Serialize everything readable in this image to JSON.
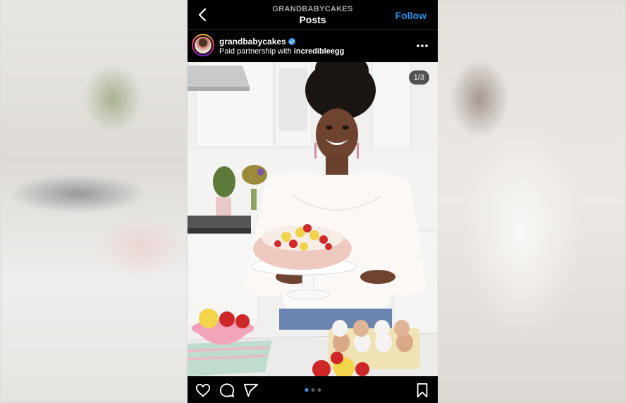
{
  "header": {
    "username": "GRANDBABYCAKES",
    "title": "Posts",
    "follow_label": "Follow"
  },
  "post": {
    "author": "grandbabycakes",
    "verified": true,
    "partnership_prefix": "Paid partnership with",
    "partner": "incredibleegg",
    "page_indicator": "1/3",
    "carousel_count": 3,
    "carousel_active_index": 0
  },
  "icons": {
    "back": "chevron-left-icon",
    "more": "more-dots-icon",
    "like": "heart-icon",
    "comment": "comment-icon",
    "share": "send-icon",
    "save": "bookmark-icon"
  },
  "colors": {
    "follow": "#1f96f2",
    "verified": "#3897f0",
    "background": "#000000"
  }
}
